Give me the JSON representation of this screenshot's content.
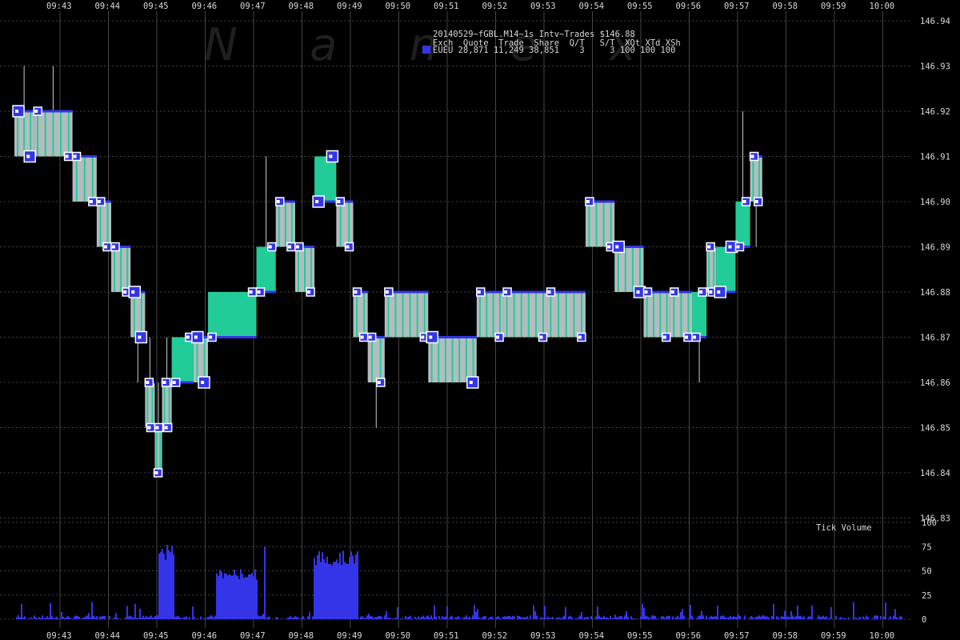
{
  "watermark": "N a n e x",
  "header": {
    "title": "20140529~fGBL.M14~1s Intv~Trades $146.88",
    "columns": "Exch  Quote  Trade  Share  Q/T   S/T  XQt XTd XSh",
    "row": "EUEU 28,871 11,249 38,851    3     3 100 100 100",
    "swatch_color": "#3434e8"
  },
  "colors": {
    "background": "#000000",
    "grid": "#444444",
    "gray_bar": "#b4bcc0",
    "green_bar": "#22cc99",
    "blue": "#3434e8",
    "text": "#d8d8d8"
  },
  "chart_data": [
    {
      "type": "candlestick",
      "x_tick_labels": [
        "09:43",
        "09:44",
        "09:45",
        "09:46",
        "09:47",
        "09:48",
        "09:49",
        "09:50",
        "09:51",
        "09:52",
        "09:53",
        "09:54",
        "09:55",
        "09:56",
        "09:57",
        "09:58",
        "09:59",
        "10:00"
      ],
      "y_tick_labels": [
        "146.83",
        "146.84",
        "146.85",
        "146.86",
        "146.87",
        "146.88",
        "146.89",
        "146.90",
        "146.91",
        "146.92",
        "146.93",
        "146.94"
      ],
      "ylim": [
        146.83,
        146.94
      ],
      "legend": {
        "series": "EUEU",
        "color": "#3434e8"
      },
      "bars": [
        {
          "t0": 0.05,
          "t1": 0.45,
          "open": 146.92,
          "close": 146.91,
          "high": 146.93,
          "low": 146.91
        },
        {
          "t0": 0.45,
          "t1": 1.25,
          "open": 146.92,
          "close": 146.91,
          "high": 146.93,
          "low": 146.91
        },
        {
          "t0": 1.25,
          "t1": 1.75,
          "open": 146.91,
          "close": 146.9,
          "high": 146.91,
          "low": 146.9
        },
        {
          "t0": 1.75,
          "t1": 2.05,
          "open": 146.9,
          "close": 146.89,
          "high": 146.9,
          "low": 146.89
        },
        {
          "t0": 2.05,
          "t1": 2.45,
          "open": 146.89,
          "close": 146.88,
          "high": 146.89,
          "low": 146.88
        },
        {
          "t0": 2.45,
          "t1": 2.75,
          "open": 146.88,
          "close": 146.87,
          "high": 146.88,
          "low": 146.86
        },
        {
          "t0": 2.75,
          "t1": 2.95,
          "open": 146.86,
          "close": 146.85,
          "high": 146.87,
          "low": 146.85
        },
        {
          "t0": 2.95,
          "t1": 3.1,
          "open": 146.85,
          "close": 146.84,
          "high": 146.86,
          "low": 146.84
        },
        {
          "t0": 3.1,
          "t1": 3.3,
          "open": 146.86,
          "close": 146.85,
          "high": 146.87,
          "low": 146.85
        },
        {
          "t0": 3.3,
          "t1": 3.75,
          "open": 146.86,
          "close": 146.87,
          "high": 146.87,
          "low": 146.86
        },
        {
          "t0": 3.75,
          "t1": 4.05,
          "open": 146.87,
          "close": 146.86,
          "high": 146.87,
          "low": 146.86
        },
        {
          "t0": 4.05,
          "t1": 5.05,
          "open": 146.87,
          "close": 146.88,
          "high": 146.88,
          "low": 146.87
        },
        {
          "t0": 5.05,
          "t1": 5.45,
          "open": 146.88,
          "close": 146.89,
          "high": 146.91,
          "low": 146.88
        },
        {
          "t0": 5.45,
          "t1": 5.85,
          "open": 146.9,
          "close": 146.89,
          "high": 146.9,
          "low": 146.89
        },
        {
          "t0": 5.85,
          "t1": 6.25,
          "open": 146.89,
          "close": 146.88,
          "high": 146.89,
          "low": 146.88
        },
        {
          "t0": 6.25,
          "t1": 6.7,
          "open": 146.9,
          "close": 146.91,
          "high": 146.91,
          "low": 146.9
        },
        {
          "t0": 6.7,
          "t1": 7.05,
          "open": 146.9,
          "close": 146.89,
          "high": 146.9,
          "low": 146.89
        },
        {
          "t0": 7.05,
          "t1": 7.35,
          "open": 146.88,
          "close": 146.87,
          "high": 146.88,
          "low": 146.87
        },
        {
          "t0": 7.35,
          "t1": 7.7,
          "open": 146.87,
          "close": 146.86,
          "high": 146.87,
          "low": 146.85
        },
        {
          "t0": 7.7,
          "t1": 8.6,
          "open": 146.88,
          "close": 146.87,
          "high": 146.88,
          "low": 146.87
        },
        {
          "t0": 8.6,
          "t1": 9.6,
          "open": 146.87,
          "close": 146.86,
          "high": 146.87,
          "low": 146.86
        },
        {
          "t0": 9.6,
          "t1": 10.15,
          "open": 146.88,
          "close": 146.87,
          "high": 146.88,
          "low": 146.87
        },
        {
          "t0": 10.15,
          "t1": 11.05,
          "open": 146.88,
          "close": 146.87,
          "high": 146.88,
          "low": 146.87
        },
        {
          "t0": 11.05,
          "t1": 11.85,
          "open": 146.88,
          "close": 146.87,
          "high": 146.88,
          "low": 146.87
        },
        {
          "t0": 11.85,
          "t1": 12.45,
          "open": 146.9,
          "close": 146.89,
          "high": 146.9,
          "low": 146.89
        },
        {
          "t0": 12.45,
          "t1": 13.05,
          "open": 146.89,
          "close": 146.88,
          "high": 146.89,
          "low": 146.88
        },
        {
          "t0": 13.05,
          "t1": 13.6,
          "open": 146.88,
          "close": 146.87,
          "high": 146.88,
          "low": 146.87
        },
        {
          "t0": 13.6,
          "t1": 14.05,
          "open": 146.88,
          "close": 146.87,
          "high": 146.88,
          "low": 146.87
        },
        {
          "t0": 14.05,
          "t1": 14.35,
          "open": 146.87,
          "close": 146.88,
          "high": 146.88,
          "low": 146.86
        },
        {
          "t0": 14.35,
          "t1": 14.55,
          "open": 146.89,
          "close": 146.88,
          "high": 146.89,
          "low": 146.88
        },
        {
          "t0": 14.55,
          "t1": 14.95,
          "open": 146.88,
          "close": 146.89,
          "high": 146.89,
          "low": 146.88
        },
        {
          "t0": 14.95,
          "t1": 15.25,
          "open": 146.89,
          "close": 146.9,
          "high": 146.92,
          "low": 146.89
        },
        {
          "t0": 15.25,
          "t1": 15.5,
          "open": 146.91,
          "close": 146.9,
          "high": 146.91,
          "low": 146.89
        }
      ]
    },
    {
      "type": "bar",
      "title": "Tick Volume",
      "y_tick_labels": [
        "0",
        "25",
        "50",
        "75",
        "100"
      ],
      "ylim": [
        0,
        100
      ],
      "bursts": [
        {
          "t0": 3.0,
          "t1": 3.35,
          "value": 74
        },
        {
          "t0": 4.2,
          "t1": 5.05,
          "value": 50
        },
        {
          "t0": 5.18,
          "t1": 5.22,
          "value": 78
        },
        {
          "t0": 6.2,
          "t1": 7.15,
          "value": 68
        }
      ]
    }
  ]
}
